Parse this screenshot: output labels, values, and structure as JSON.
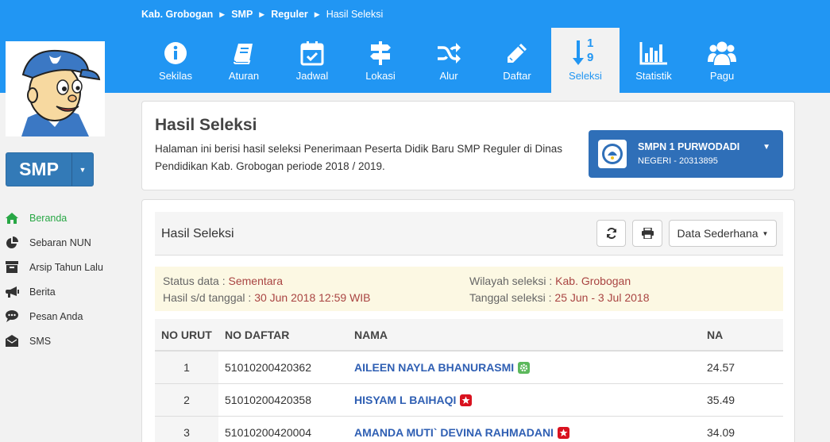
{
  "breadcrumb": [
    "Kab. Grobogan",
    "SMP",
    "Reguler",
    "Hasil Seleksi"
  ],
  "nav": [
    {
      "label": "Sekilas",
      "icon": "info-icon"
    },
    {
      "label": "Aturan",
      "icon": "book-icon"
    },
    {
      "label": "Jadwal",
      "icon": "calendar-check-icon"
    },
    {
      "label": "Lokasi",
      "icon": "signpost-icon"
    },
    {
      "label": "Alur",
      "icon": "random-icon"
    },
    {
      "label": "Daftar",
      "icon": "pencil-icon"
    },
    {
      "label": "Seleksi",
      "icon": "sort-numeric-icon",
      "active": true,
      "icon_text_top": "1",
      "icon_text_bottom": "9"
    },
    {
      "label": "Statistik",
      "icon": "bar-chart-icon"
    },
    {
      "label": "Pagu",
      "icon": "users-icon"
    }
  ],
  "level": {
    "label": "SMP"
  },
  "sidebar": {
    "items": [
      {
        "label": "Beranda",
        "icon": "home-icon",
        "active": true
      },
      {
        "label": "Sebaran NUN",
        "icon": "pie-chart-icon"
      },
      {
        "label": "Arsip Tahun Lalu",
        "icon": "archive-icon"
      },
      {
        "label": "Berita",
        "icon": "bullhorn-icon"
      },
      {
        "label": "Pesan Anda",
        "icon": "comment-icon"
      },
      {
        "label": "SMS",
        "icon": "envelope-icon"
      }
    ]
  },
  "header": {
    "title": "Hasil Seleksi",
    "description": "Halaman ini berisi hasil seleksi Penerimaan Peserta Didik Baru SMP Reguler di Dinas Pendidikan Kab. Grobogan periode 2018 / 2019."
  },
  "school": {
    "name": "SMPN 1 PURWODADI",
    "sub": "NEGERI - 20313895"
  },
  "panel": {
    "title": "Hasil Seleksi",
    "view_label": "Data Sederhana"
  },
  "info": {
    "status_label": "Status data :",
    "status_value": "Sementara",
    "hasil_label": "Hasil s/d tanggal :",
    "hasil_value": "30 Jun 2018 12:59 WIB",
    "wilayah_label": "Wilayah seleksi :",
    "wilayah_value": "Kab. Grobogan",
    "tanggal_label": "Tanggal seleksi :",
    "tanggal_value": "25 Jun - 3 Jul 2018"
  },
  "table": {
    "headers": [
      "NO URUT",
      "NO DAFTAR",
      "NAMA",
      "NA"
    ],
    "rows": [
      {
        "no": "1",
        "daftar": "51010200420362",
        "nama": "AILEEN NAYLA BHANURASMI",
        "badge": "green",
        "na": "24.57"
      },
      {
        "no": "2",
        "daftar": "51010200420358",
        "nama": "HISYAM L BAIHAQI",
        "badge": "red",
        "na": "35.49"
      },
      {
        "no": "3",
        "daftar": "51010200420004",
        "nama": "AMANDA MUTI` DEVINA RAHMADANI",
        "badge": "red",
        "na": "34.09"
      }
    ]
  },
  "colors": {
    "primary": "#2196f3",
    "school_button": "#2f6fb8",
    "active_green": "#28a745",
    "value_red": "#a94442"
  }
}
